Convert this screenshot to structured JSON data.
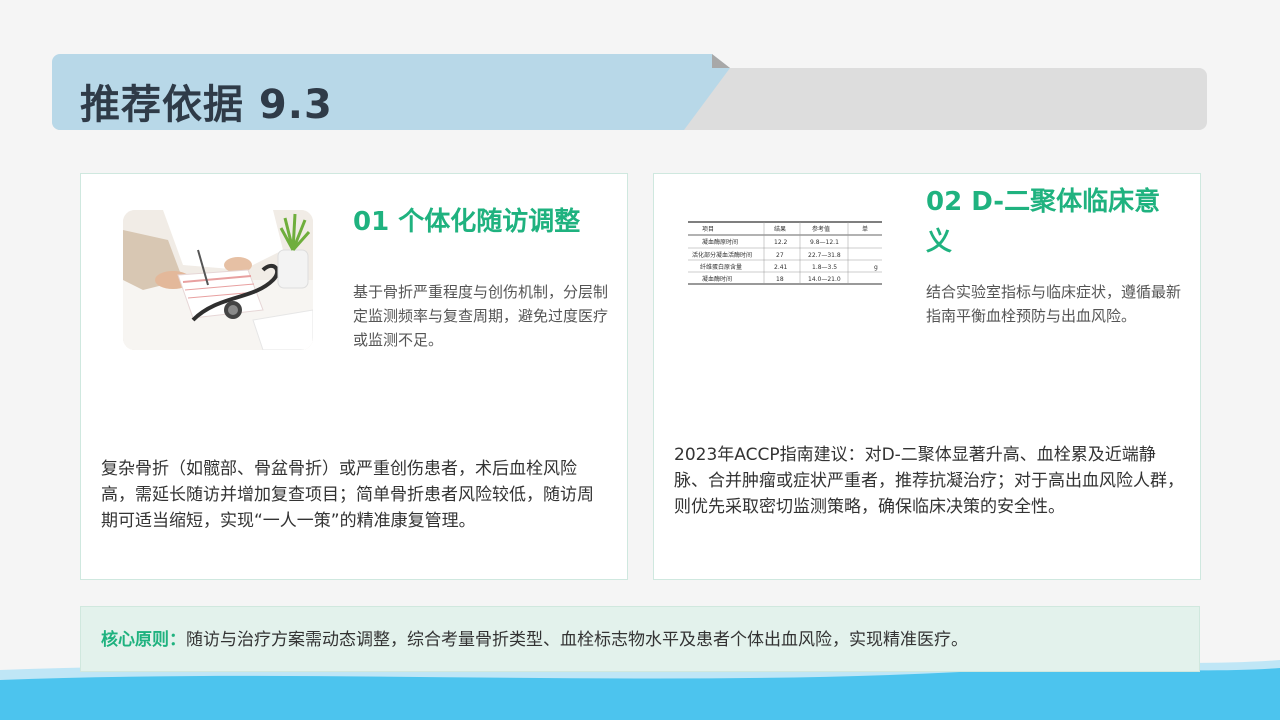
{
  "header": {
    "title": "推荐依据 9.3"
  },
  "cards": [
    {
      "title": "01 个体化随访调整",
      "description": "基于骨折严重程度与创伤机制，分层制定监测频率与复查周期，避免过度医疗或监测不足。",
      "body": "复杂骨折（如髋部、骨盆骨折）或严重创伤患者，术后血栓风险高，需延长随访并增加复查项目；简单骨折患者风险较低，随访周期可适当缩短，实现“一人一策”的精准康复管理。"
    },
    {
      "title": "02 D-二聚体临床意义",
      "description": "结合实验室指标与临床症状，遵循最新指南平衡血栓预防与出血风险。",
      "body": "2023年ACCP指南建议：对D-二聚体显著升高、血栓累及近端静脉、合并肿瘤或症状严重者，推荐抗凝治疗；对于高出血风险人群，则优先采取密切监测策略，确保临床决策的安全性。"
    }
  ],
  "lab_table": {
    "headers": [
      "项目",
      "结果",
      "参考值",
      "单"
    ],
    "rows": [
      [
        "凝血酶原时间",
        "12.2",
        "9.8—12.1",
        ""
      ],
      [
        "活化部分凝血活酶时间",
        "27",
        "22.7—31.8",
        ""
      ],
      [
        "纤维蛋白原含量",
        "2.41",
        "1.8—3.5",
        "g"
      ],
      [
        "凝血酶时间",
        "18",
        "14.0—21.0",
        ""
      ]
    ]
  },
  "note": {
    "label": "核心原则：",
    "text": "随访与治疗方案需动态调整，综合考量骨折类型、血栓标志物水平及患者个体出血风险，实现精准医疗。"
  },
  "colors": {
    "accent_green": "#1fb27f",
    "header_blue": "#b8d8e8",
    "wave_blue": "#4cc4ee"
  }
}
